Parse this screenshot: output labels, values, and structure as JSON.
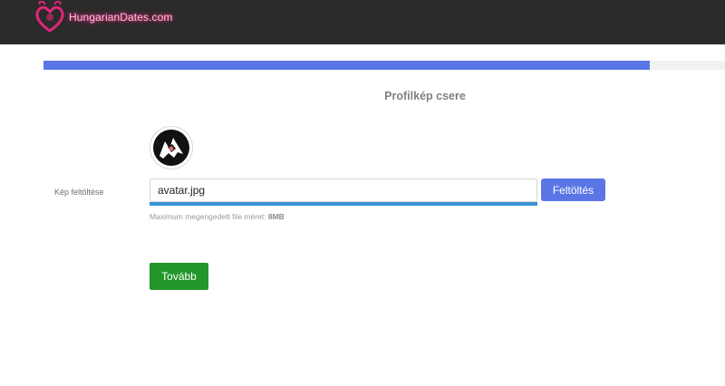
{
  "header": {
    "logo_text": "HungarianDates.com",
    "logo_icon": "heart-logo-icon"
  },
  "progress": {
    "percent": 89
  },
  "page": {
    "title": "Profilkép csere"
  },
  "avatar": {
    "icon": "avatar-image"
  },
  "upload": {
    "label": "Kép feltöltése",
    "file_value": "avatar.jpg",
    "button_label": "Feltöltés",
    "help_prefix": "Maximum megengedett file méret:",
    "help_size": "8MB"
  },
  "actions": {
    "next_label": "Tovább"
  },
  "colors": {
    "topbar": "#2b2b2b",
    "accent_blue": "#5a76e6",
    "upload_bar": "#3a93d6",
    "next_green": "#22962a",
    "logo_pink": "#e0267a"
  }
}
